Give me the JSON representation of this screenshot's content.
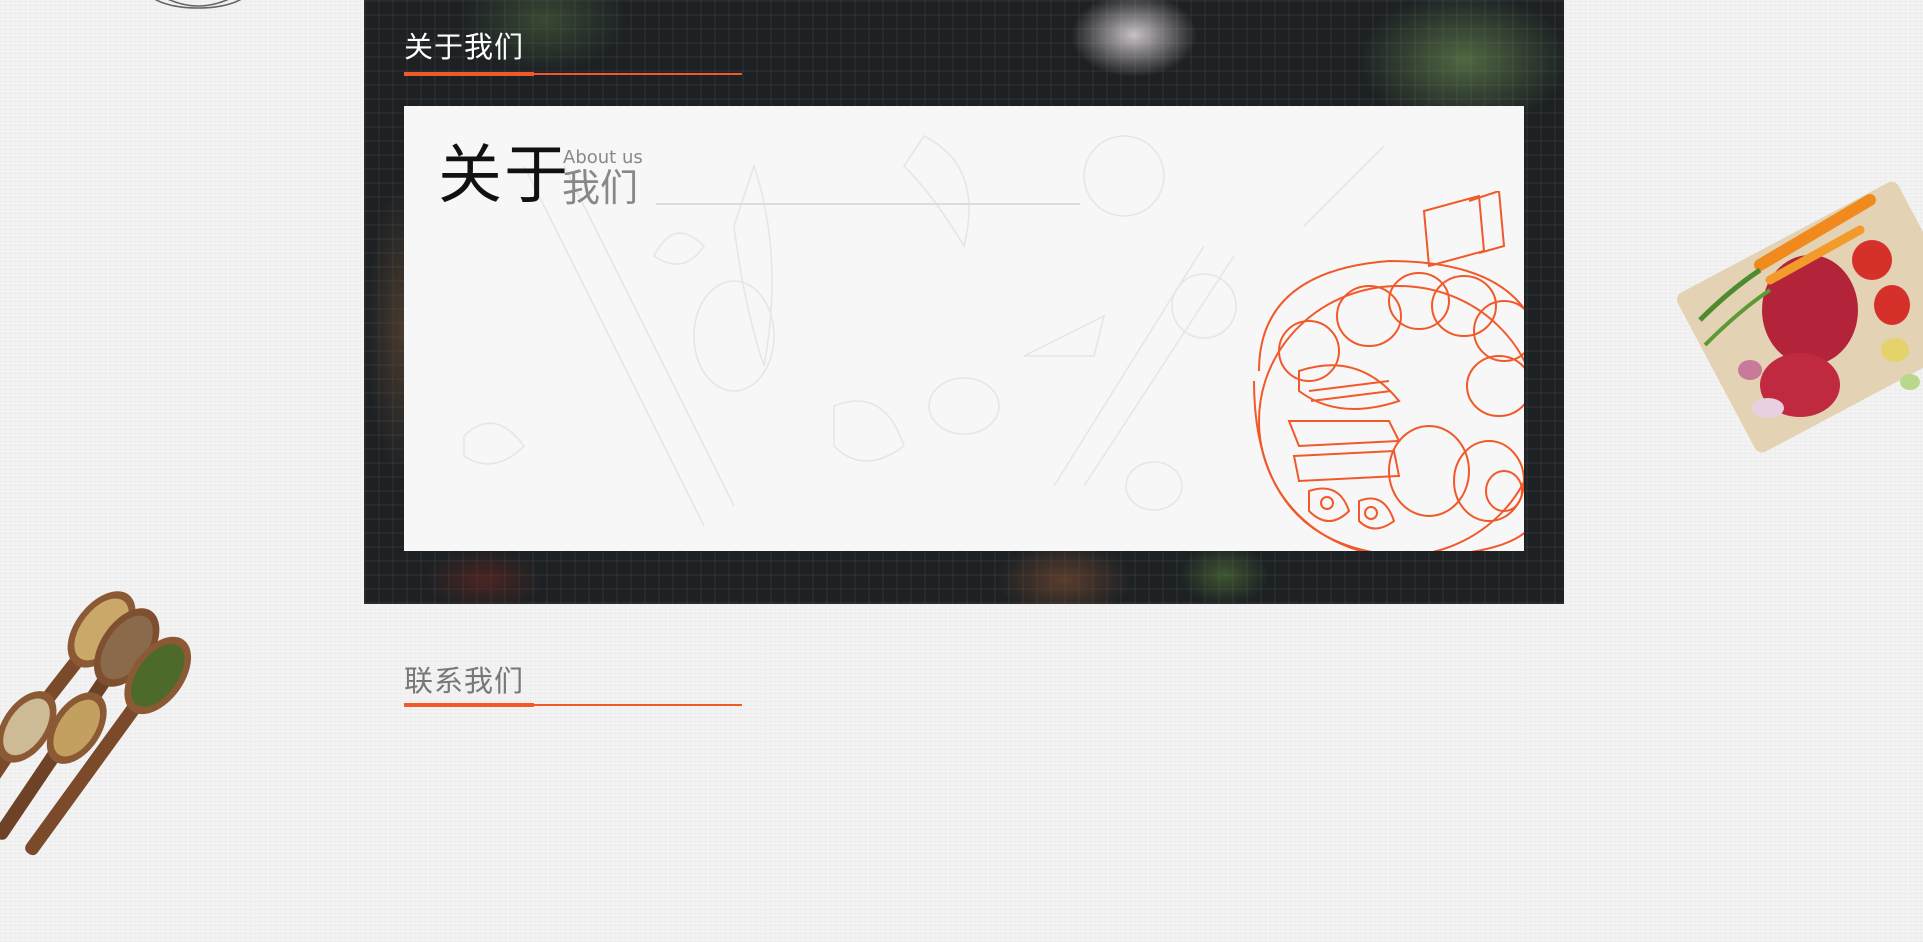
{
  "about": {
    "heading": "关于我们",
    "card": {
      "title_big": "关于",
      "title_en": "About us",
      "title_small": "我们"
    }
  },
  "contact": {
    "heading": "联系我们"
  },
  "colors": {
    "accent": "#f1592a",
    "panel_dark": "#1d2124",
    "card_bg": "#f7f7f7",
    "heading_white": "#ffffff",
    "heading_gray": "#777777"
  },
  "icons": {
    "top_decoration": "dish-sketch-icon",
    "left_decoration": "spice-spoons-image",
    "right_decoration": "meat-cutting-board-image",
    "card_illustration": "noodle-bowl-icon"
  }
}
